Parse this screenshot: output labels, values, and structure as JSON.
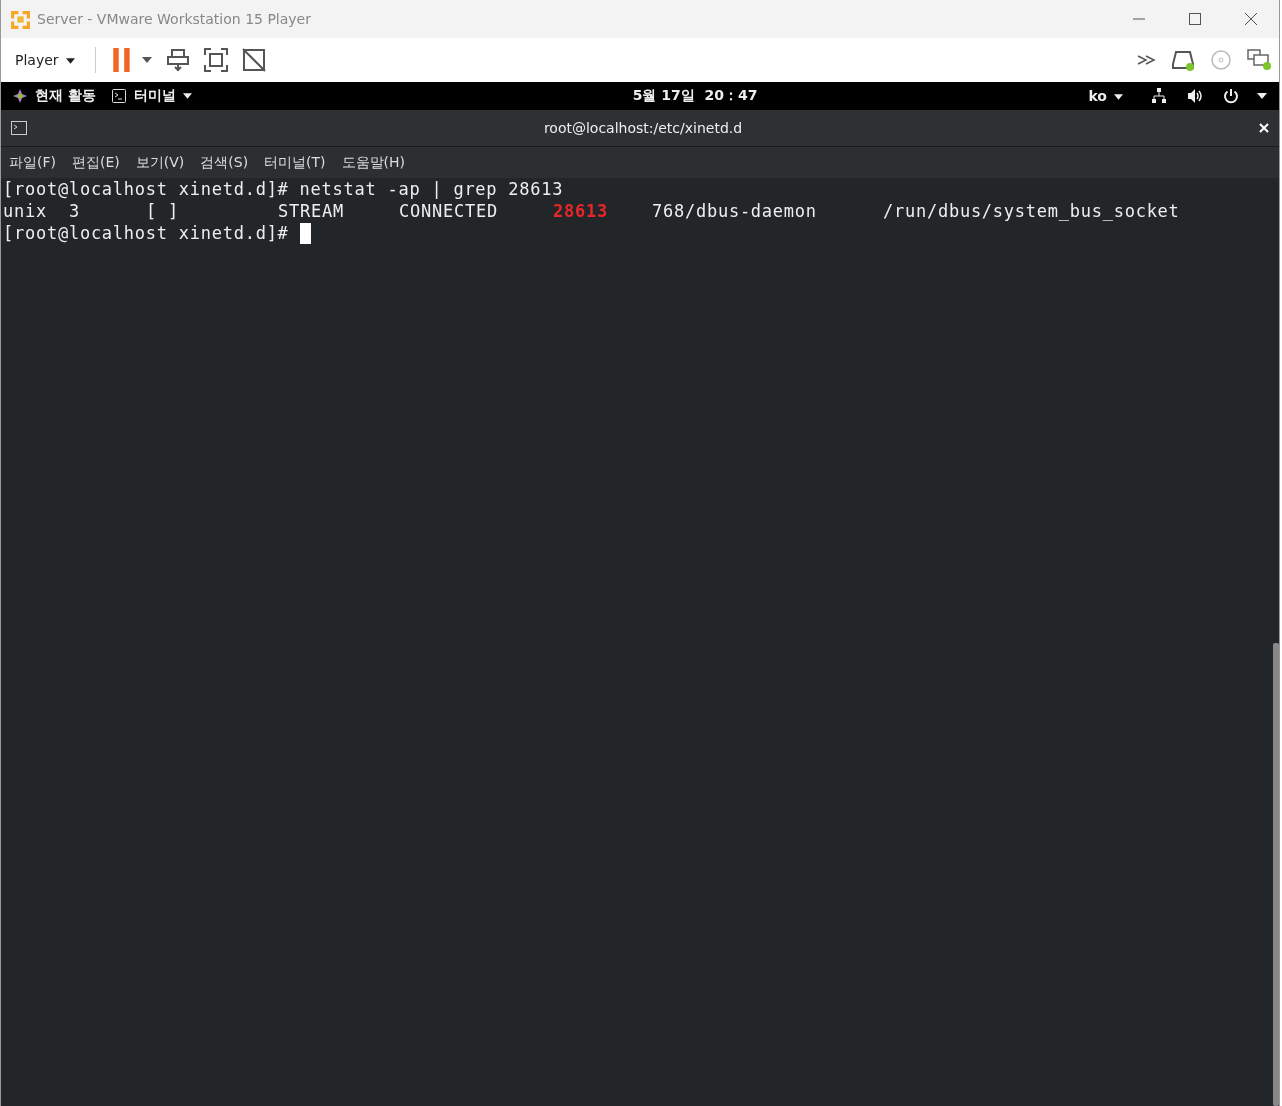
{
  "window": {
    "title": "Server - VMware Workstation 15 Player"
  },
  "toolbar": {
    "player_menu": "Player"
  },
  "topbar": {
    "activities": "현재 활동",
    "app_menu": "터미널",
    "clock": "5월 17일  20：47",
    "input_method": "ko"
  },
  "terminal": {
    "title": "root@localhost:/etc/xinetd.d",
    "menu": [
      "파일(F)",
      "편집(E)",
      "보기(V)",
      "검색(S)",
      "터미널(T)",
      "도움말(H)"
    ],
    "lines": [
      {
        "kind": "prompt",
        "prompt": "[root@localhost xinetd.d]#",
        "command": "netstat -ap | grep 28613"
      },
      {
        "kind": "columns",
        "cells": [
          {
            "text": "unix",
            "highlight": false
          },
          {
            "text": "3",
            "highlight": false
          },
          {
            "text": "[ ]",
            "highlight": false
          },
          {
            "text": "STREAM",
            "highlight": false
          },
          {
            "text": "CONNECTED",
            "highlight": false
          },
          {
            "text": "28613",
            "highlight": true
          },
          {
            "text": "768/dbus-daemon",
            "highlight": false
          },
          {
            "text": "/run/dbus/system_bus_socket",
            "highlight": false
          }
        ]
      },
      {
        "kind": "prompt",
        "prompt": "[root@localhost xinetd.d]#",
        "cursor": true
      }
    ]
  }
}
